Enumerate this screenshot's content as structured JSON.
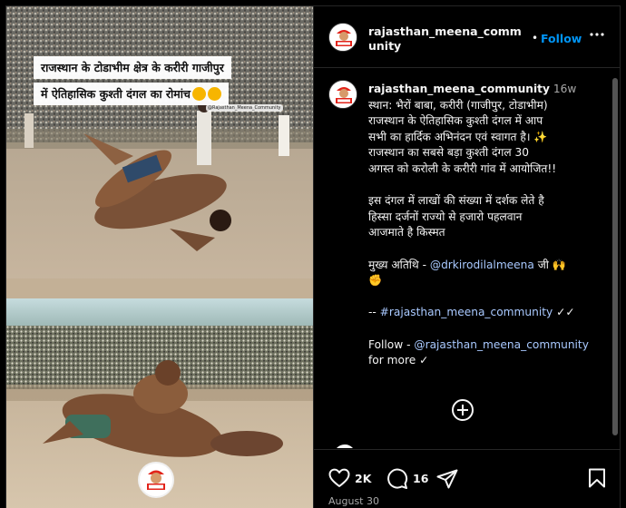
{
  "post": {
    "caption_overlay": {
      "line1": "राजस्थान के टोडाभीम क्षेत्र के करीरी गाजीपुर",
      "line2": "में ऐतिहासिक कुश्ती दंगल का रोमांच",
      "watermark": "@Rajasthan_Meena_Community"
    },
    "logo_text": "MEENA"
  },
  "header": {
    "username": "rajasthan_meena_community",
    "separator": "•",
    "follow_label": "Follow",
    "more_label": "•••"
  },
  "caption": {
    "username": "rajasthan_meena_community",
    "time": "16w",
    "lines": [
      "स्थान: भैरों बाबा, करीरी (गाजीपुर, टोडाभीम)",
      "राजस्थान के ऐतिहासिक कुश्ती दंगल में आप",
      "सभी का हार्दिक अभिनंदन एवं स्वागत है। ✨",
      "राजस्थान का सबसे बड़ा कुश्ती दंगल 30",
      "अगस्त को करोली के करीरी गांव में आयोजित!!"
    ],
    "para2": [
      "इस दंगल में लाखों की संख्या में दर्शक लेते है",
      "हिस्सा दर्जनों राज्यो से हजारो पहलवान",
      "आजमाते है किस्मत"
    ],
    "chief_guest_prefix": "मुख्य अतिथि - ",
    "chief_guest_mention": "@drkirodilalmeena",
    "chief_guest_suffix": " जी 🙌",
    "chief_guest_emoji": "✊",
    "hashtag_prefix": "-- ",
    "hashtag": "#rajasthan_meena_community",
    "hashtag_suffix": " ✓✓",
    "follow_prefix": "Follow - ",
    "follow_mention": "@rajasthan_meena_community",
    "follow_suffix": "for more ✓"
  },
  "actions": {
    "likes": "2K",
    "comments": "16",
    "date": "August 30"
  },
  "colors": {
    "background": "#000000",
    "follow_blue": "#0095f6",
    "border": "#262626",
    "secondary_text": "#a8a8a8"
  },
  "icons": [
    "more-icon",
    "heart-icon",
    "comment-icon",
    "share-icon",
    "bookmark-icon",
    "add-comment-icon"
  ]
}
